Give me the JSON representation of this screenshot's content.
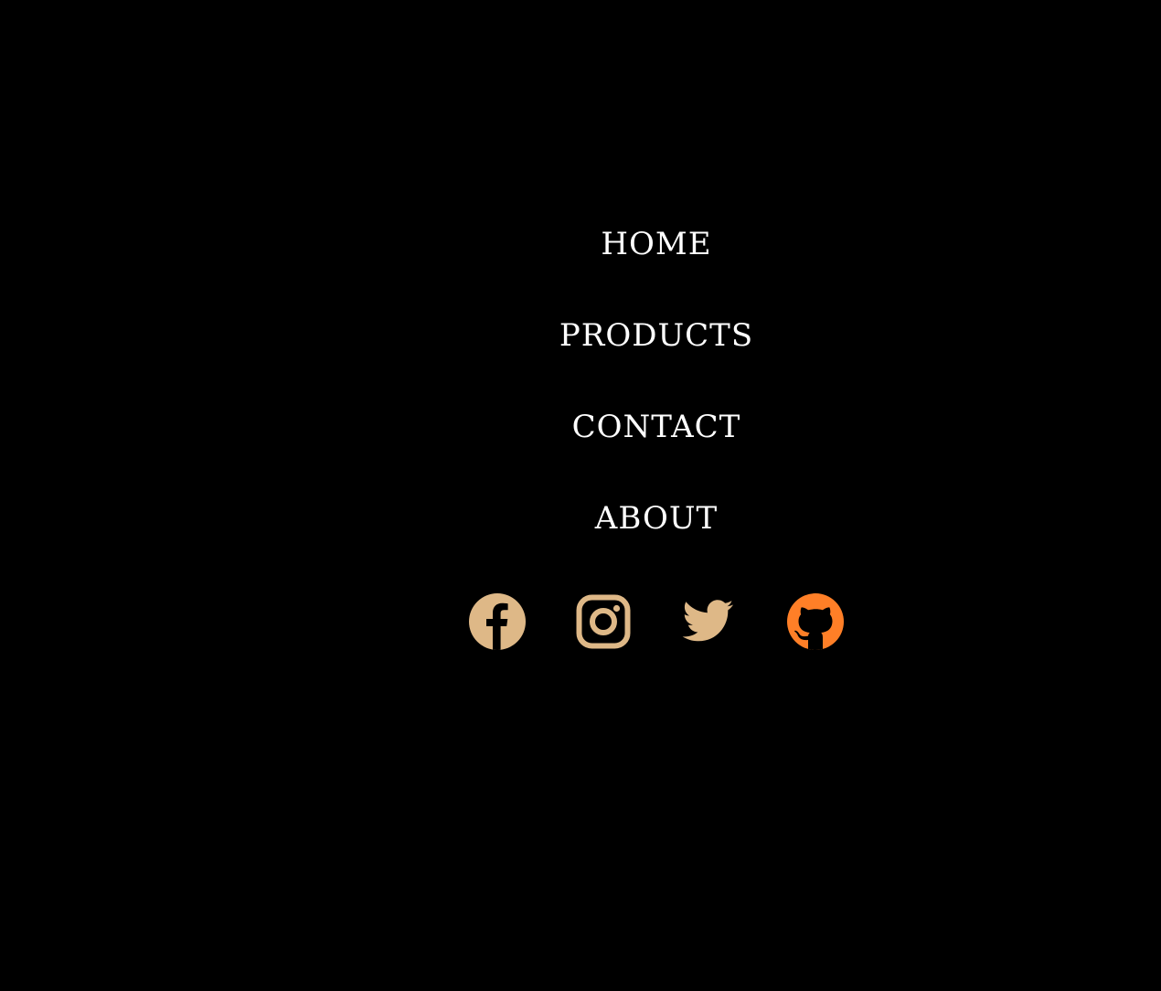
{
  "nav": {
    "items": [
      {
        "label": "HOME"
      },
      {
        "label": "PRODUCTS"
      },
      {
        "label": "CONTACT"
      },
      {
        "label": "ABOUT"
      }
    ],
    "text_color": "#ffffff"
  },
  "social": {
    "icons": [
      {
        "name": "facebook-icon",
        "color": "#deb887"
      },
      {
        "name": "instagram-icon",
        "color": "#deb887"
      },
      {
        "name": "twitter-icon",
        "color": "#deb887"
      },
      {
        "name": "github-icon",
        "color": "#ff7f27"
      }
    ]
  },
  "page": {
    "background": "#000000"
  }
}
